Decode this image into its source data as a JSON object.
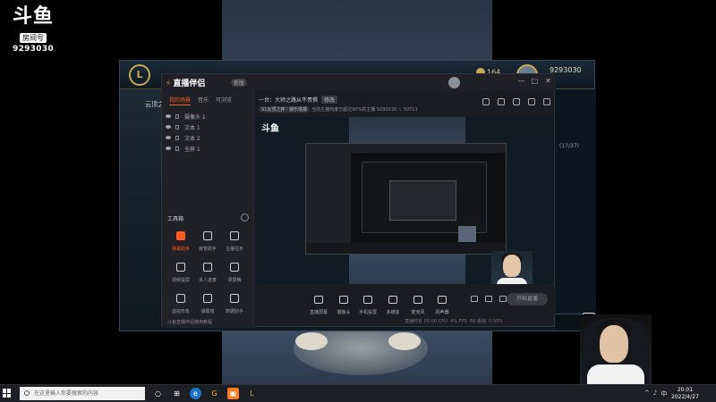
{
  "brand": {
    "logo_text": "斗鱼",
    "room_label": "房间号",
    "room_number": "9293030"
  },
  "lol_client": {
    "logo": "L",
    "currency": "164",
    "player_id": "9293030",
    "side_label": "云顶之",
    "right_text": [
      "(17/37)"
    ]
  },
  "app": {
    "title": "直播伴侣",
    "version": "新版",
    "window_controls": [
      "—",
      "□",
      "✕"
    ],
    "sidebar_tabs": [
      "我的场景",
      "音乐",
      "可浏览"
    ],
    "layers": [
      "摄像头 1",
      "文本 1",
      "文本 2",
      "全屏 1"
    ],
    "tools_header": "工具箱",
    "tools": [
      {
        "label": "弹幕助手",
        "icon": "danmaku-icon",
        "active": true
      },
      {
        "label": "房管助手",
        "icon": "admin-icon",
        "active": false
      },
      {
        "label": "主播任务",
        "icon": "task-icon",
        "active": false
      },
      {
        "label": "视频投屏",
        "icon": "cast-icon",
        "active": false
      },
      {
        "label": "多人连麦",
        "icon": "multi-mic-icon",
        "active": false
      },
      {
        "label": "录屏精",
        "icon": "record-icon",
        "active": false
      },
      {
        "label": "虚拟形象",
        "icon": "avatar-icon",
        "active": false
      },
      {
        "label": "弹幕墙",
        "icon": "wall-icon",
        "active": false
      },
      {
        "label": "数据助手",
        "icon": "data-icon",
        "active": false
      }
    ],
    "footer": "斗鱼直播伴侣使用教程",
    "room_title": "一台：大师之路从不畏惧",
    "room_edit": "修改",
    "room_category": "S1云顶之弈 · 娱乐情报",
    "room_meta": "当前主播热度已超过90%的主播  9293030  ♨ 59711",
    "controls": [
      {
        "label": "直播屏幕",
        "icon": "screen-icon"
      },
      {
        "label": "摄像头",
        "icon": "camera-icon"
      },
      {
        "label": "手机投屏",
        "icon": "phone-icon"
      },
      {
        "label": "多媒体",
        "icon": "media-icon"
      },
      {
        "label": "麦克风",
        "icon": "mic-icon"
      },
      {
        "label": "扬声器",
        "icon": "speaker-icon"
      }
    ],
    "start_button": "开始直播",
    "status": "直播时长 00:00  CPU: 4%  FPS: 60  丢帧: 0.00%"
  },
  "taskbar": {
    "search_placeholder": "在这里输入你要搜索的内容",
    "apps": [
      "○",
      "⊞",
      "e",
      "G",
      "▣",
      "L"
    ],
    "tray": [
      "^",
      "♪",
      "中"
    ],
    "time": "20:01",
    "date": "2022/4/27"
  },
  "colors": {
    "accent": "#ff5a1e",
    "lol_gold": "#c8a85a"
  }
}
